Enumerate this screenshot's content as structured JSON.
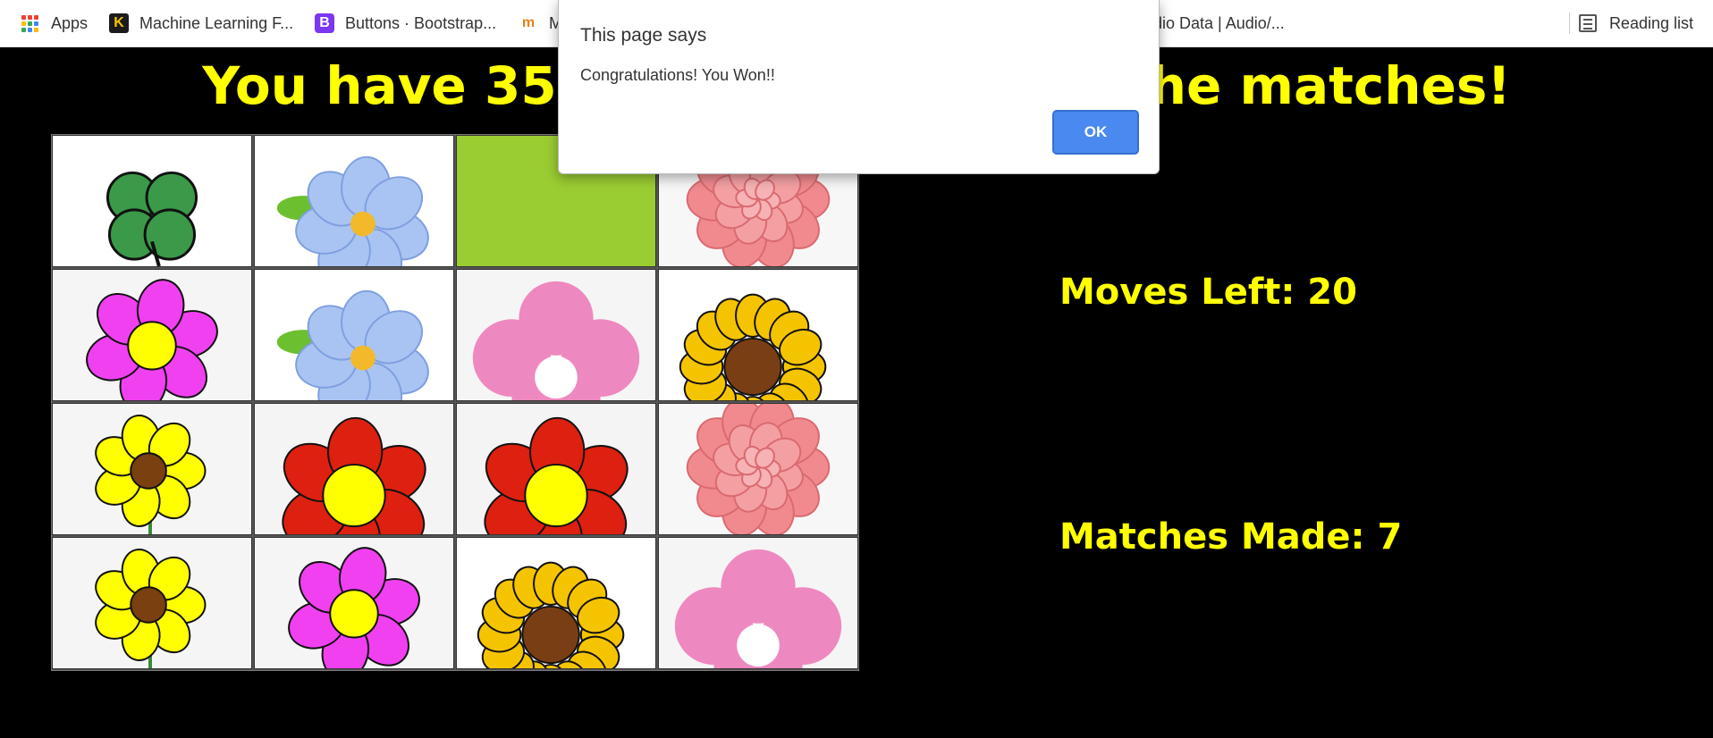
{
  "bookmarks": {
    "apps_label": "Apps",
    "items": [
      {
        "label": "Machine Learning F...",
        "icon": "k-icon"
      },
      {
        "label": "Buttons · Bootstrap...",
        "icon": "bootstrap-icon"
      },
      {
        "label": "M",
        "icon": "moodle-icon"
      },
      {
        "label": "udio Data | Audio/...",
        "icon": "audio-icon"
      }
    ],
    "reading_list_label": "Reading list"
  },
  "game": {
    "heading": "You have 35 moves to make all the matches!",
    "moves_left": "Moves Left: 20",
    "matches_made": "Matches Made: 7",
    "cards": [
      [
        "clover",
        "blue-flower",
        "back",
        "pink-dahlia"
      ],
      [
        "magenta-flower",
        "blue-flower",
        "pink-blossom",
        "sunflower"
      ],
      [
        "yellow-daisy",
        "red-flower",
        "red-flower",
        "pink-dahlia"
      ],
      [
        "yellow-daisy",
        "magenta-flower",
        "sunflower",
        "pink-blossom"
      ]
    ],
    "card_back_color": "#9acd32"
  },
  "dialog": {
    "title": "This page says",
    "message": "Congratulations! You Won!!",
    "ok_label": "OK"
  },
  "colors": {
    "accent_yellow": "#ffff00",
    "ok_blue": "#4a89f0"
  }
}
